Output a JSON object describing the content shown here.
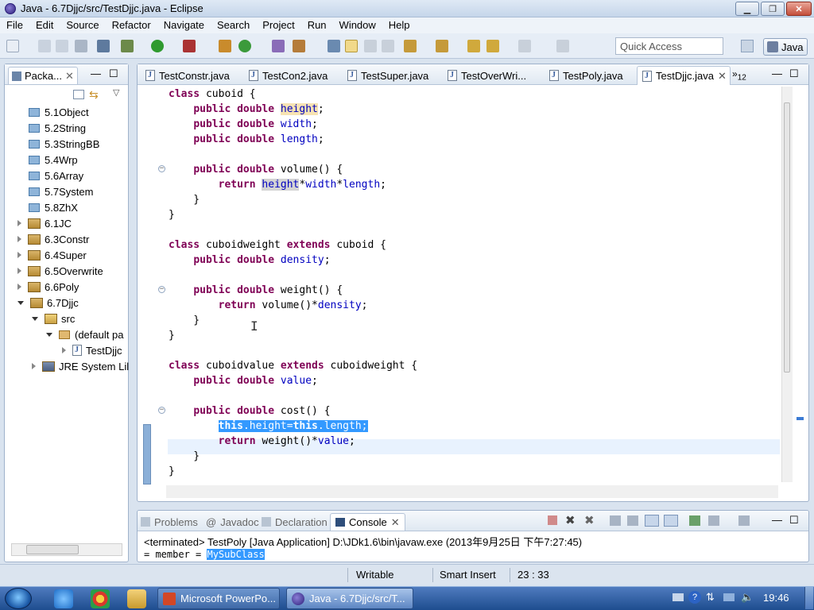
{
  "window": {
    "title": "Java - 6.7Djjc/src/TestDjjc.java - Eclipse"
  },
  "menubar": {
    "items": [
      "File",
      "Edit",
      "Source",
      "Refactor",
      "Navigate",
      "Search",
      "Project",
      "Run",
      "Window",
      "Help"
    ]
  },
  "toolbar": {
    "quick_access_placeholder": "Quick Access",
    "perspective_label": "Java"
  },
  "package_explorer": {
    "tab_label": "Packa...",
    "items": [
      {
        "label": "5.1Object",
        "kind": "package"
      },
      {
        "label": "5.2String",
        "kind": "package"
      },
      {
        "label": "5.3StringBB",
        "kind": "package"
      },
      {
        "label": "5.4Wrp",
        "kind": "package"
      },
      {
        "label": "5.6Array",
        "kind": "package"
      },
      {
        "label": "5.7System",
        "kind": "package"
      },
      {
        "label": "5.8ZhX",
        "kind": "package"
      },
      {
        "label": "6.1JC",
        "kind": "project"
      },
      {
        "label": "6.3Constr",
        "kind": "project"
      },
      {
        "label": "6.4Super",
        "kind": "project"
      },
      {
        "label": "6.5Overwrite",
        "kind": "project"
      },
      {
        "label": "6.6Poly",
        "kind": "project"
      },
      {
        "label": "6.7Djjc",
        "kind": "project"
      },
      {
        "label": "src",
        "kind": "folder"
      },
      {
        "label": "(default pa",
        "kind": "defpackage"
      },
      {
        "label": "TestDjjc",
        "kind": "file"
      },
      {
        "label": "JRE System Lil",
        "kind": "library"
      }
    ]
  },
  "editor": {
    "tabs": [
      "TestConstr.java",
      "TestCon2.java",
      "TestSuper.java",
      "TestOverWri...",
      "TestPoly.java",
      "TestDjjc.java"
    ],
    "active_tab": "TestDjjc.java",
    "overflow_count": "12",
    "code": {
      "l1_a": "class",
      "l1_b": " cuboid {",
      "l2_a": "public",
      "l2_b": "double",
      "l2_c": "height",
      "l3_a": "public",
      "l3_b": "double",
      "l3_c": "width",
      "l4_a": "public",
      "l4_b": "double",
      "l4_c": "length",
      "l6_a": "public",
      "l6_b": "double",
      "l6_c": " volume() {",
      "l7_a": "return",
      "l7_b": "height",
      "l7_c": "width",
      "l7_d": "length",
      "l11_a": "class",
      "l11_b": " cuboidweight ",
      "l11_c": "extends",
      "l11_d": " cuboid {",
      "l12_a": "public",
      "l12_b": "double",
      "l12_c": "density",
      "l14_a": "public",
      "l14_b": "double",
      "l14_c": " weight() {",
      "l15_a": "return",
      "l15_b": " volume()*",
      "l15_c": "density",
      "l19_a": "class",
      "l19_b": " cuboidvalue ",
      "l19_c": "extends",
      "l19_d": " cuboidweight {",
      "l20_a": "public",
      "l20_b": "double",
      "l20_c": "value",
      "l22_a": "public",
      "l22_b": "double",
      "l22_c": " cost() {",
      "l23_a": "this",
      "l23_b": "height",
      "l23_c": "this",
      "l23_d": "length",
      "l24_a": "return",
      "l24_b": " weight()*",
      "l24_c": "value"
    }
  },
  "console": {
    "tabs": [
      "Problems",
      "Javadoc",
      "Declaration",
      "Console"
    ],
    "active_tab": "Console",
    "status_line": "<terminated> TestPoly [Java Application] D:\\JDk1.6\\bin\\javaw.exe (2013年9月25日 下午7:27:45)",
    "partial_line": "= member = ",
    "partial_selected": "MySubClass"
  },
  "statusbar": {
    "mode": "Writable",
    "insert": "Smart Insert",
    "position": "23 : 33"
  },
  "taskbar": {
    "items": [
      "Microsoft PowerPo...",
      "Java - 6.7Djjc/src/T..."
    ],
    "clock": "19:46"
  }
}
